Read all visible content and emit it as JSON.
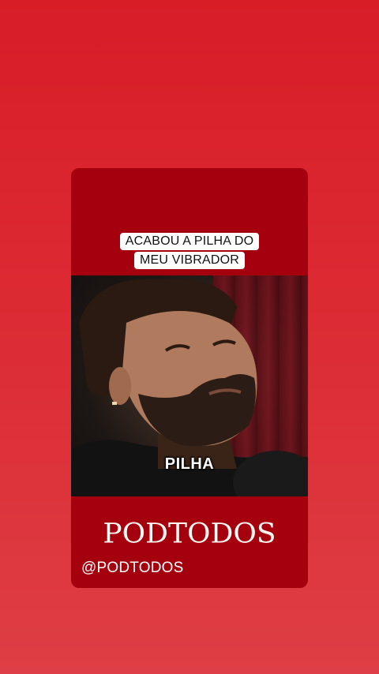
{
  "post": {
    "caption_line1": "ACABOU A PILHA DO",
    "caption_line2": "MEU VIBRADOR",
    "video_subtitle": "PILHA",
    "brand": "PODTODOS",
    "handle": "@PODTODOS"
  },
  "colors": {
    "background": "#d81d27",
    "card": "#a4000e",
    "caption_bg": "#ffffff"
  }
}
